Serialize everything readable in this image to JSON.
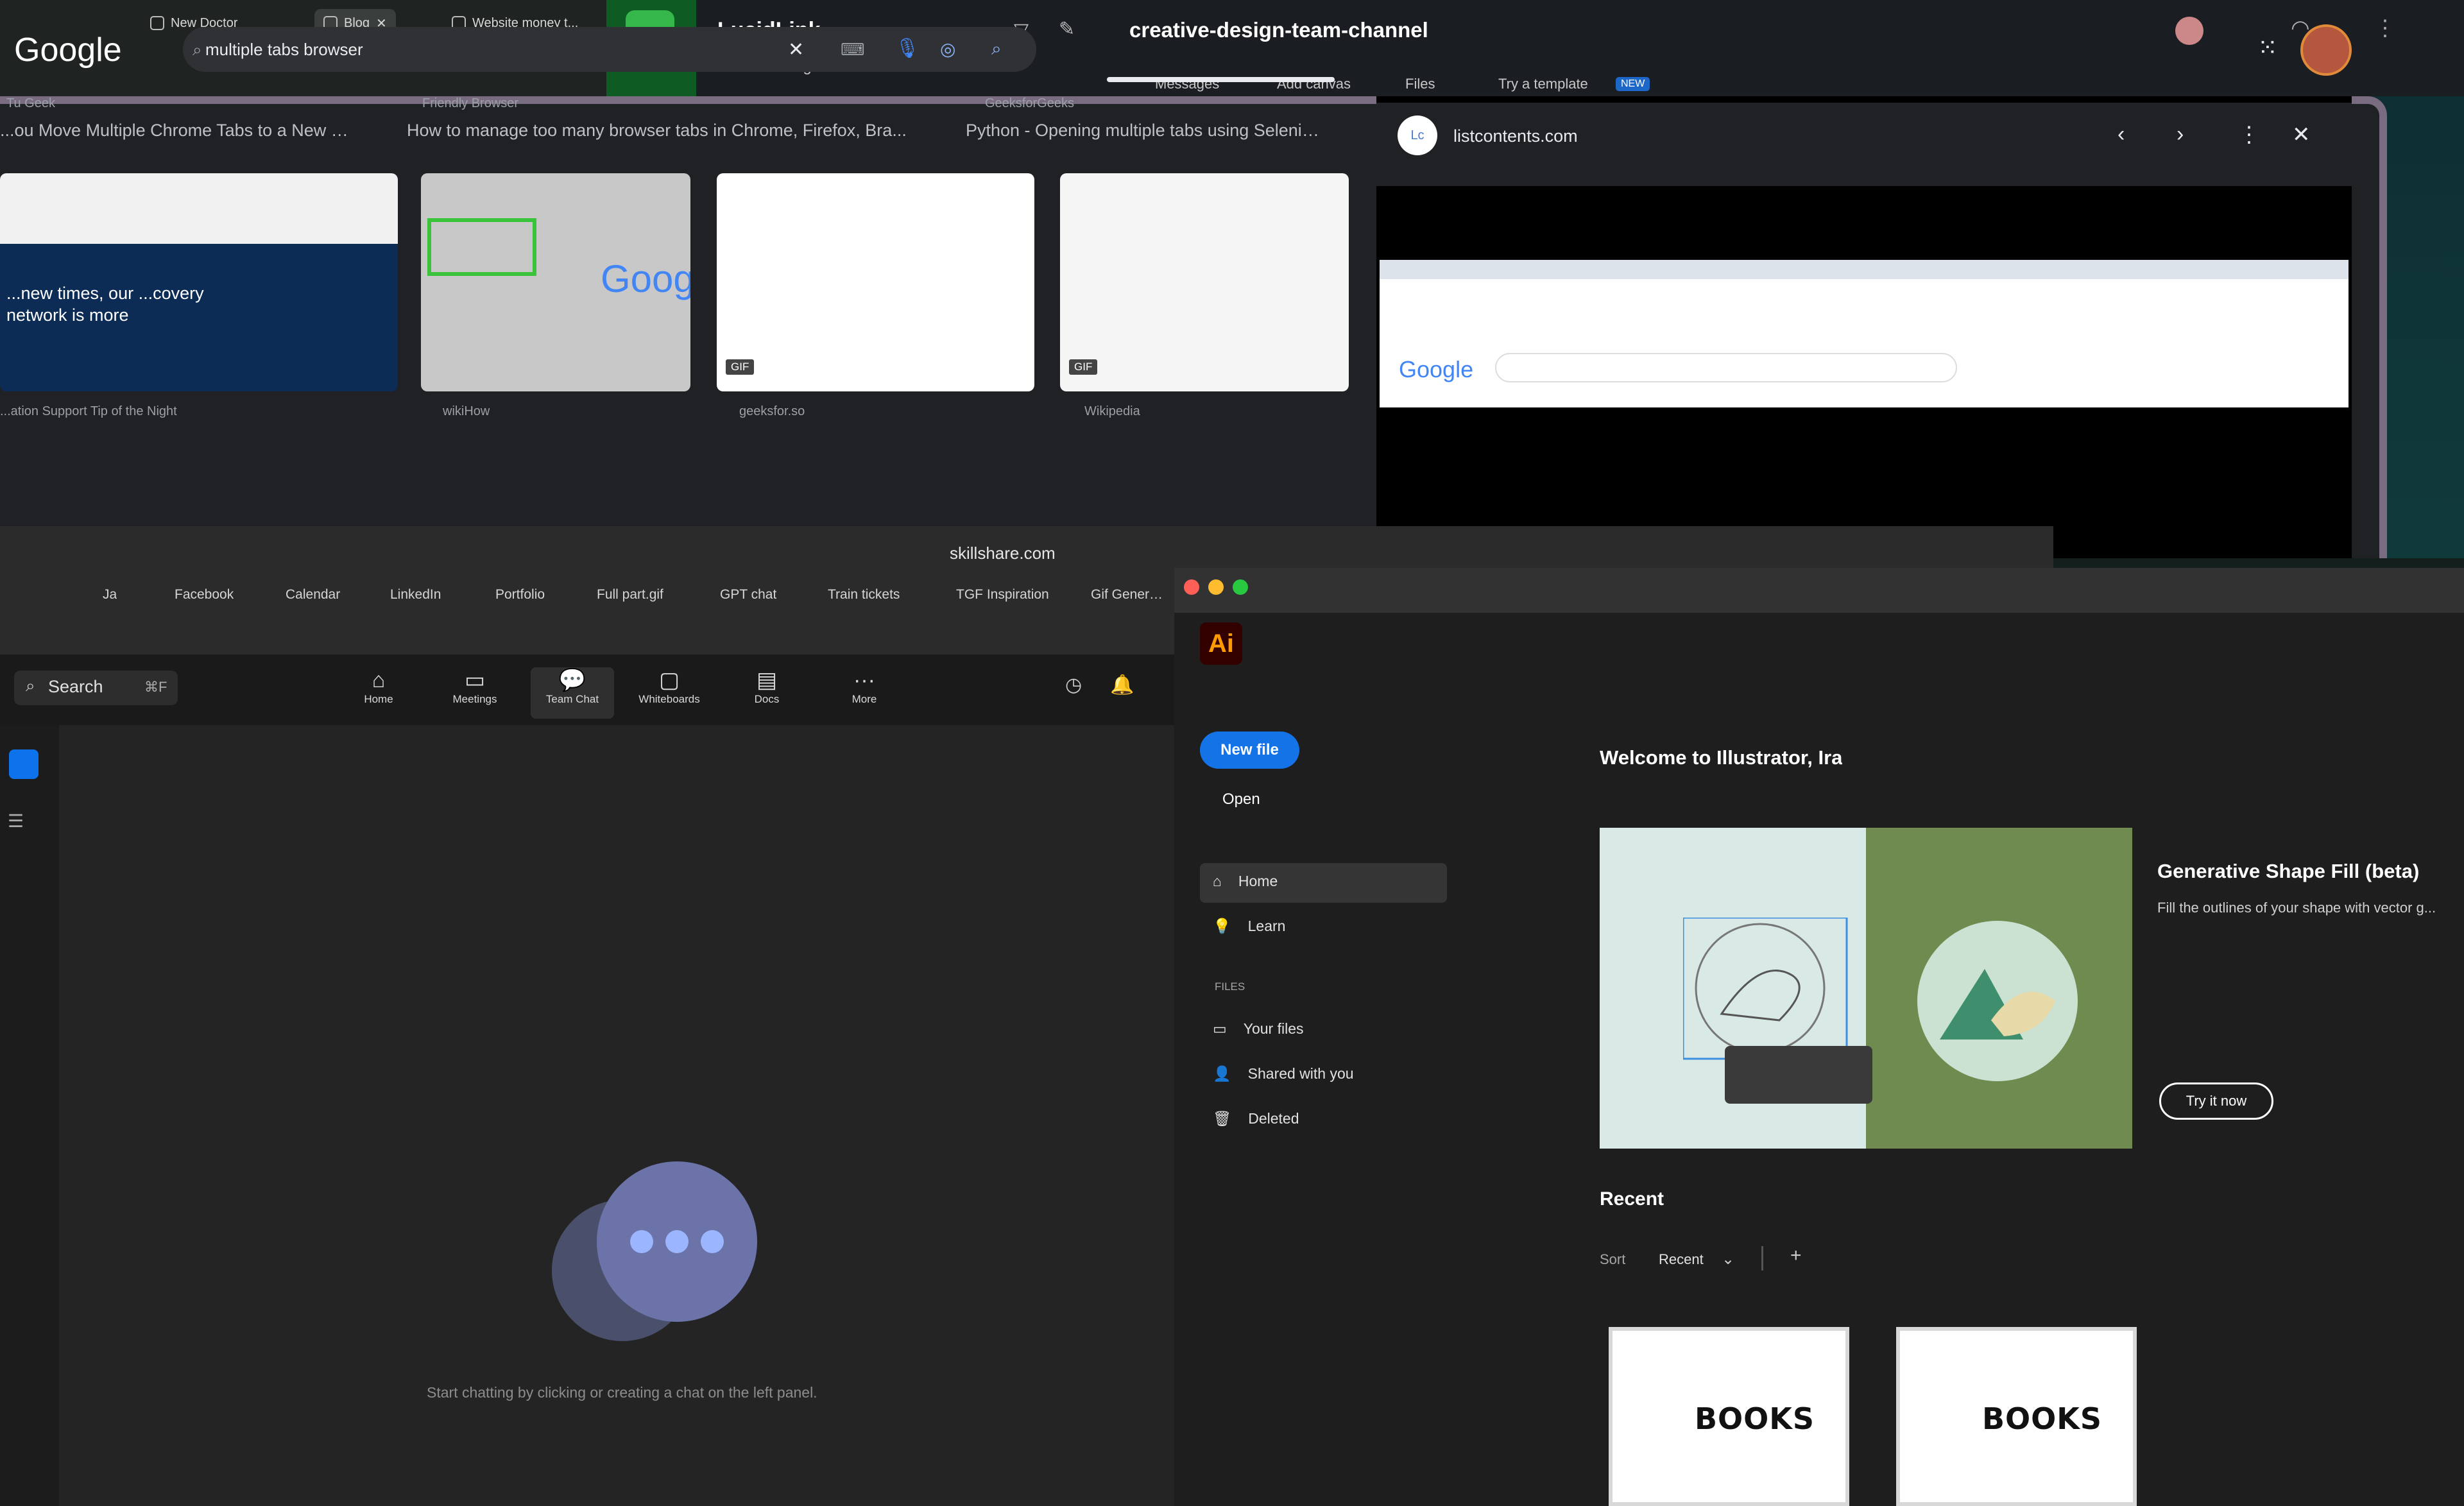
{
  "top_browser": {
    "tabs": [
      {
        "label": "New Doctor"
      },
      {
        "label": "Blog"
      },
      {
        "label": "Website money t..."
      }
    ]
  },
  "slack": {
    "workspace": "LucidLink",
    "status": "Presenting",
    "channel": "creative-design-team-channel",
    "subnav": [
      "Messages",
      "Add canvas",
      "Files",
      "Try a template"
    ],
    "new_badge": "NEW"
  },
  "chrome_search": {
    "logo": "Google",
    "query": "multiple tabs browser",
    "results": [
      {
        "source": "Tu Geek",
        "title": "...ou Move Multiple Chrome Tabs to a New Win..."
      },
      {
        "source": "Friendly Browser",
        "title": "How to manage too many browser tabs in Chrome, Firefox, Bra..."
      },
      {
        "source": "GeeksforGeeks",
        "title": "Python - Opening multiple tabs using Seleniu..."
      }
    ],
    "thumb_captions": [
      "...ation Support Tip of the Night",
      "wikiHow",
      "geeksfor.so",
      "Wikipedia"
    ],
    "thumb_overlay_text": "...new times, our ...covery network is more",
    "gif_badge": "GIF",
    "preview_domain": "listcontents.com"
  },
  "safari": {
    "url": "skillshare.com",
    "bookmarks": [
      "Ja",
      "Facebook",
      "Calendar",
      "LinkedIn",
      "Portfolio",
      "Full part.gif",
      "GPT chat",
      "Train tickets",
      "TGF Inspiration",
      "Gif Generator"
    ]
  },
  "zoom": {
    "search_label": "Search",
    "search_shortcut": "⌘F",
    "nav": [
      {
        "icon": "home-icon",
        "label": "Home"
      },
      {
        "icon": "meetings-icon",
        "label": "Meetings"
      },
      {
        "icon": "team-chat-icon",
        "label": "Team Chat"
      },
      {
        "icon": "whiteboards-icon",
        "label": "Whiteboards"
      },
      {
        "icon": "docs-icon",
        "label": "Docs"
      },
      {
        "icon": "more-icon",
        "label": "More"
      }
    ],
    "empty_state": "Start chatting by clicking or creating a chat on the left panel."
  },
  "illustrator": {
    "app_badge": "Ai",
    "new_file": "New file",
    "open": "Open",
    "nav": [
      {
        "icon": "home-icon",
        "label": "Home"
      },
      {
        "icon": "learn-icon",
        "label": "Learn"
      }
    ],
    "files_heading": "FILES",
    "files_nav": [
      {
        "icon": "file-icon",
        "label": "Your files"
      },
      {
        "icon": "shared-icon",
        "label": "Shared with you"
      },
      {
        "icon": "trash-icon",
        "label": "Deleted"
      }
    ],
    "welcome": "Welcome to Illustrator, Ira",
    "feature_title": "Generative Shape Fill (beta)",
    "feature_desc": "Fill the outlines of your shape with vector g...",
    "try_button": "Try it now",
    "recent_heading": "Recent",
    "sort_label": "Sort",
    "sort_value": "Recent",
    "recent_files": [
      {
        "art_text": "BOOKS"
      },
      {
        "art_text": "BOOKS"
      }
    ]
  },
  "colors": {
    "accent_blue": "#1473e6",
    "lucid_green": "#35b74a",
    "ai_orange": "#ff9a00"
  }
}
